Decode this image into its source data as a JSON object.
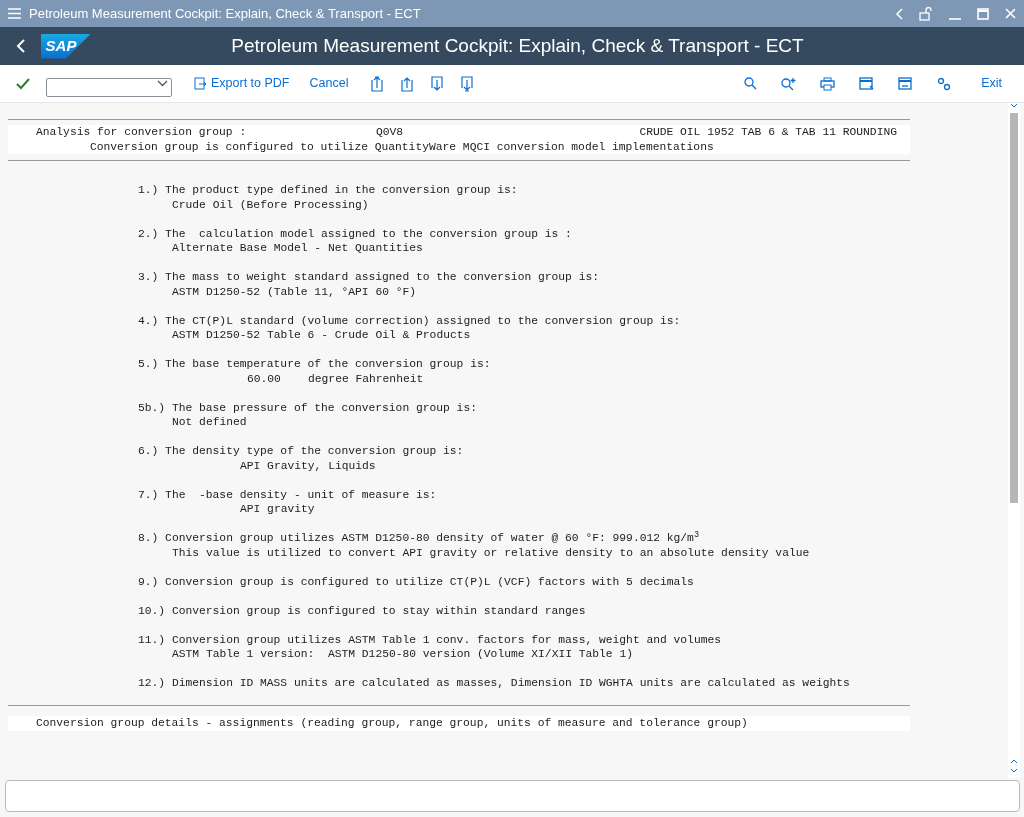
{
  "window": {
    "title": "Petroleum Measurement Cockpit: Explain, Check & Transport - ECT"
  },
  "header": {
    "title": "Petroleum Measurement Cockpit: Explain, Check & Transport - ECT",
    "logo": "SAP"
  },
  "toolbar": {
    "export_button": "Export to PDF",
    "cancel_button": "Cancel",
    "exit_button": "Exit"
  },
  "report": {
    "header": {
      "label": "Analysis for conversion group :",
      "group": "Q0V8",
      "description": "CRUDE OIL 1952 TAB 6 & TAB 11 ROUNDING",
      "subtitle": "Conversion group is configured to utilize QuantityWare MQCI conversion model implementations"
    },
    "items": [
      {
        "number": "1.)",
        "text": "The product type defined in the conversion group is:",
        "details": [
          {
            "kind": "text",
            "text": "Crude Oil (Before Processing)"
          }
        ]
      },
      {
        "number": "2.)",
        "text": "The  calculation model assigned to the conversion group is :",
        "details": [
          {
            "kind": "text",
            "text": "Alternate Base Model - Net Quantities"
          }
        ]
      },
      {
        "number": "3.)",
        "text": "The mass to weight standard assigned to the conversion group is:",
        "details": [
          {
            "kind": "text",
            "text": "ASTM D1250-52 (Table 11, °API 60 °F)"
          }
        ]
      },
      {
        "number": "4.)",
        "text": "The CT(P)L standard (volume correction) assigned to the conversion group is:",
        "details": [
          {
            "kind": "text",
            "text": "ASTM D1250-52 Table 6 - Crude Oil & Products"
          }
        ]
      },
      {
        "number": "5.)",
        "text": "The base temperature of the conversion group is:",
        "details": [
          {
            "kind": "number",
            "text": "60.00    degree Fahrenheit"
          }
        ]
      },
      {
        "number": "5b.)",
        "text": "The base pressure of the conversion group is:",
        "details": [
          {
            "kind": "text",
            "text": "Not defined"
          }
        ]
      },
      {
        "number": "6.)",
        "text": "The density type of the conversion group is:",
        "details": [
          {
            "kind": "value",
            "text": "API Gravity, Liquids"
          }
        ]
      },
      {
        "number": "7.)",
        "text": "The  -base density - unit of measure is:",
        "details": [
          {
            "kind": "value",
            "text": "API gravity"
          }
        ]
      },
      {
        "number": "8.)",
        "text": "Conversion group utilizes ASTM D1250-80 density of water @ 60 °F: 999.012 kg/m$^{3}$",
        "details": [
          {
            "kind": "text",
            "text": "This value is utilized to convert API gravity or relative density to an absolute density value"
          }
        ]
      },
      {
        "number": "9.)",
        "text": "Conversion group is configured to utilize CT(P)L (VCF) factors with 5 decimals"
      },
      {
        "number": "10.)",
        "text": "Conversion group is configured to stay within standard ranges"
      },
      {
        "number": "11.)",
        "text": "Conversion group utilizes ASTM Table 1 conv. factors for mass, weight and volumes",
        "details": [
          {
            "kind": "text",
            "text": "ASTM Table 1 version:  ASTM D1250-80 version (Volume XI/XII Table 1)"
          }
        ]
      },
      {
        "number": "12.)",
        "text": "Dimension ID MASS units are calculated as masses, Dimension ID WGHTA units are calculated as weights"
      }
    ],
    "footer": "Conversion group details - assignments (reading group, range group, units of measure and tolerance group)"
  }
}
